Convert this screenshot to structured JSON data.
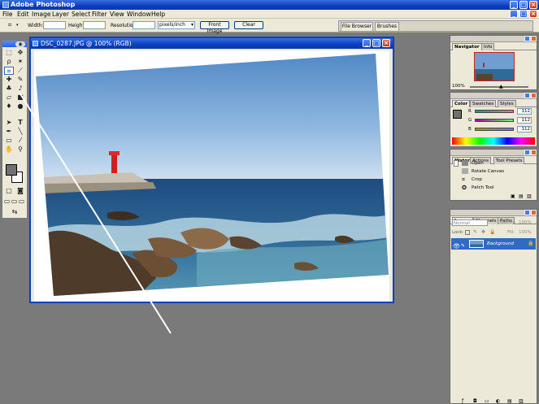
{
  "app": {
    "title": "Adobe Photoshop"
  },
  "menu": {
    "items": [
      {
        "label": "File",
        "mnemonic": "F"
      },
      {
        "label": "Edit",
        "mnemonic": "E"
      },
      {
        "label": "Image",
        "mnemonic": "I"
      },
      {
        "label": "Layer",
        "mnemonic": "L"
      },
      {
        "label": "Select",
        "mnemonic": "S"
      },
      {
        "label": "Filter",
        "mnemonic": "T"
      },
      {
        "label": "View",
        "mnemonic": "V"
      },
      {
        "label": "Window",
        "mnemonic": "W"
      },
      {
        "label": "Help",
        "mnemonic": "H"
      }
    ]
  },
  "options": {
    "width_label": "Width:",
    "height_label": "Height:",
    "resolution_label": "Resolution:",
    "resolution_unit": "pixels/inch",
    "front_image_label": "Front Image",
    "clear_label": "Clear",
    "file_browser_tab": "File Browser",
    "brushes_tab": "Brushes"
  },
  "document": {
    "title": "DSC_0287.JPG @ 100% (RGB)"
  },
  "navigator": {
    "tabs": [
      "Navigator",
      "Info"
    ],
    "zoom": "100%"
  },
  "color": {
    "tabs": [
      "Color",
      "Swatches",
      "Styles"
    ],
    "channels": [
      {
        "label": "R",
        "value": "112"
      },
      {
        "label": "G",
        "value": "112"
      },
      {
        "label": "B",
        "value": "112"
      }
    ],
    "foreground": "#707070"
  },
  "history": {
    "tabs": [
      "History",
      "Actions",
      "Tool Presets"
    ],
    "items": [
      "Open",
      "Rotate Canvas",
      "Crop",
      "Patch Tool"
    ]
  },
  "layers": {
    "tabs": [
      "Layers",
      "Channels",
      "Paths"
    ],
    "blend_mode": "Normal",
    "opacity_label": "Opacity:",
    "opacity_value": "100%",
    "lock_label": "Lock:",
    "fill_label": "Fill:",
    "fill_value": "100%",
    "layer_name": "Background"
  },
  "colors": {
    "titlebar": "#0a3fc0",
    "workspace": "#7a7a7a",
    "panel_bg": "#ece9d8",
    "selection": "#316ac5"
  }
}
